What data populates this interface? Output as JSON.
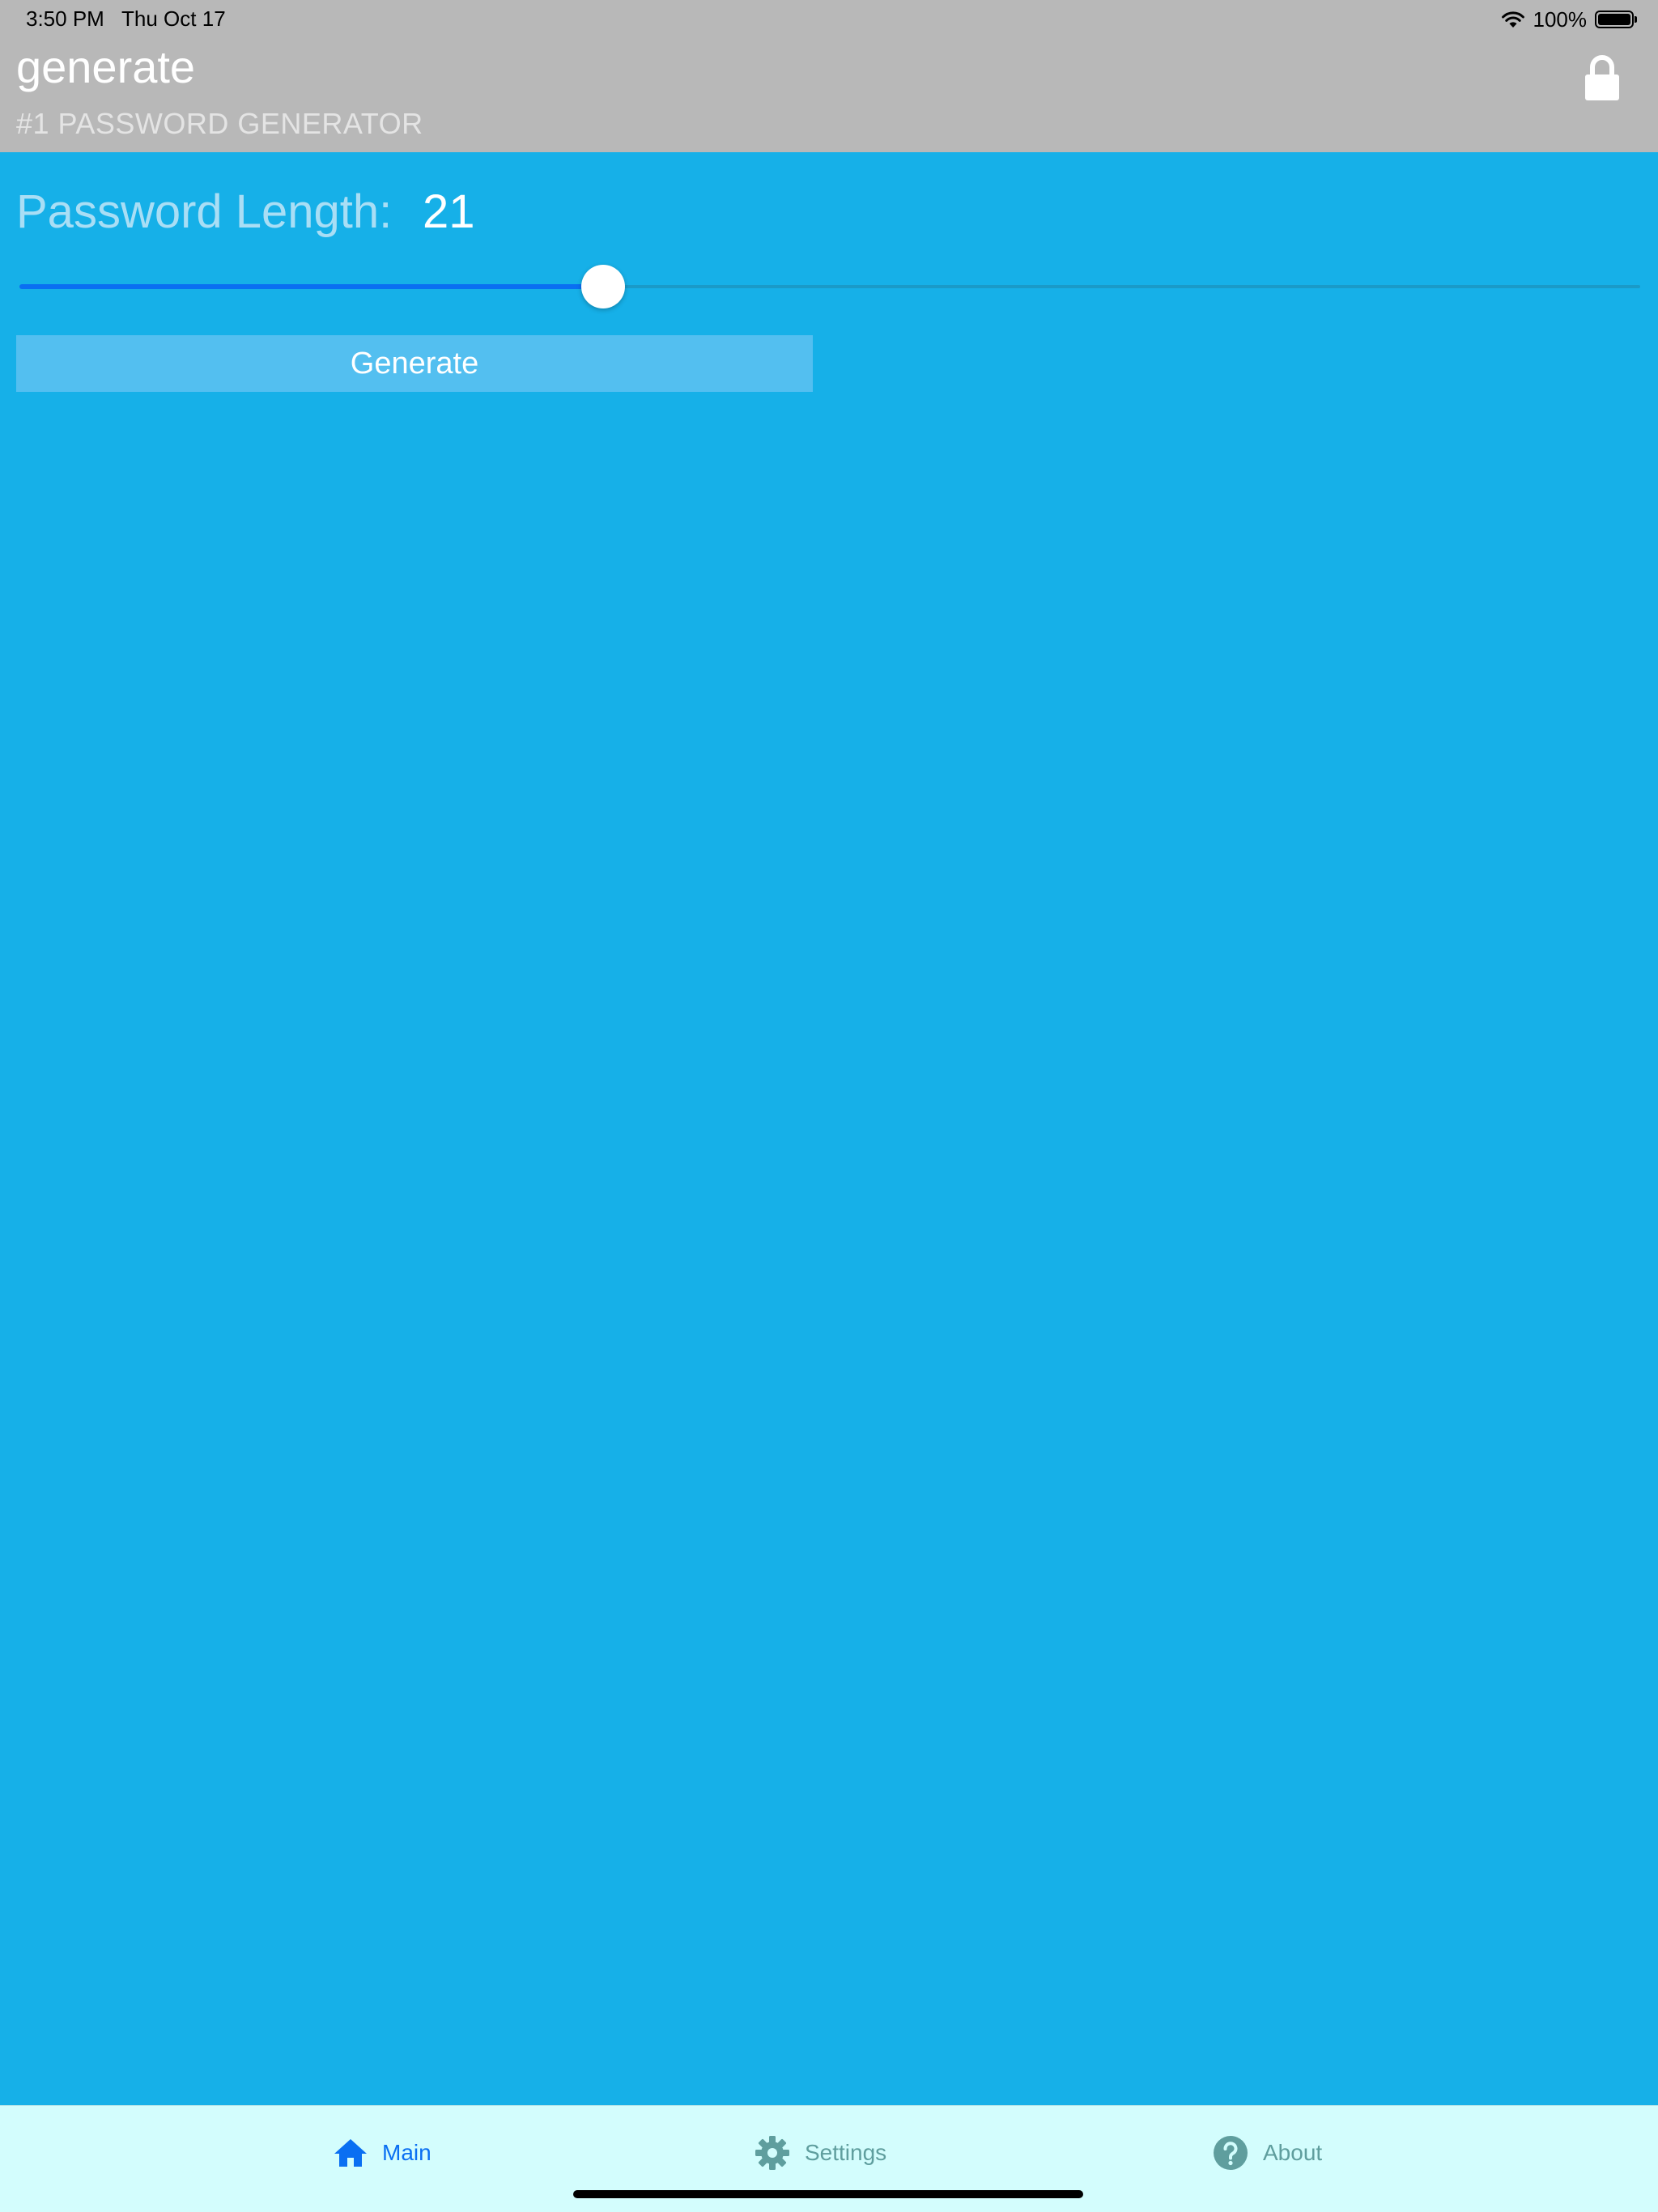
{
  "status_bar": {
    "time": "3:50 PM",
    "date": "Thu Oct 17",
    "battery_text": "100%",
    "battery_level": 1.0
  },
  "header": {
    "title": "generate",
    "subtitle": "#1 PASSWORD GENERATOR",
    "lock_icon": "lock-icon"
  },
  "main": {
    "length_label": "Password Length:",
    "length_value": "21",
    "slider": {
      "value": 21,
      "min": 1,
      "max": 59,
      "fraction": 0.36
    },
    "generate_label": "Generate"
  },
  "tabbar": {
    "tabs": [
      {
        "label": "Main",
        "icon": "home-icon",
        "selected": true
      },
      {
        "label": "Settings",
        "icon": "gear-icon",
        "selected": false
      },
      {
        "label": "About",
        "icon": "question-circle-icon",
        "selected": false
      }
    ]
  },
  "colors": {
    "background": "#16b0e8",
    "header": "#b8b8b8",
    "accent": "#0a6ff2",
    "button": "#53bff0",
    "tabbar": "#d3fdfd",
    "tab_inactive": "#5f9e9e"
  }
}
